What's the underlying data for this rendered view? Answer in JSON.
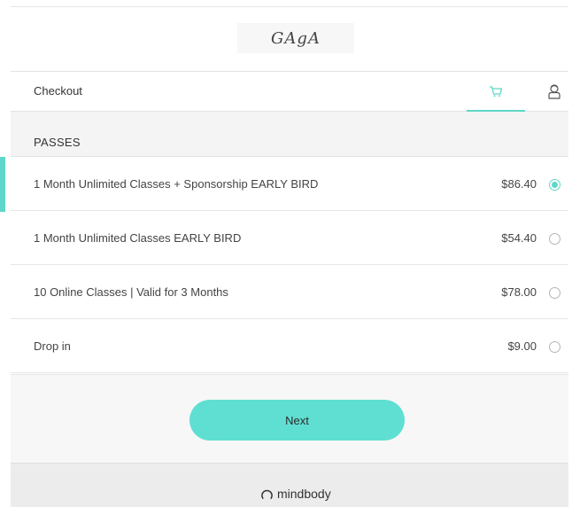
{
  "logo": {
    "text": "GAgA"
  },
  "header": {
    "title": "Checkout",
    "cart_icon": "cart-icon",
    "user_icon": "user-icon"
  },
  "section": {
    "title": "PASSES"
  },
  "passes": [
    {
      "name": "1 Month Unlimited Classes + Sponsorship EARLY BIRD",
      "price": "$86.40",
      "selected": true
    },
    {
      "name": "1 Month Unlimited Classes EARLY BIRD",
      "price": "$54.40",
      "selected": false
    },
    {
      "name": "10 Online Classes | Valid for 3 Months",
      "price": "$78.00",
      "selected": false
    },
    {
      "name": "Drop in",
      "price": "$9.00",
      "selected": false
    }
  ],
  "actions": {
    "next_label": "Next"
  },
  "footer": {
    "brand": "mindbody",
    "brand_icon": "mindbody-logo-icon"
  },
  "colors": {
    "accent": "#5fd7c8",
    "button": "#5fdfd2",
    "section_bg": "#f4f4f4"
  }
}
